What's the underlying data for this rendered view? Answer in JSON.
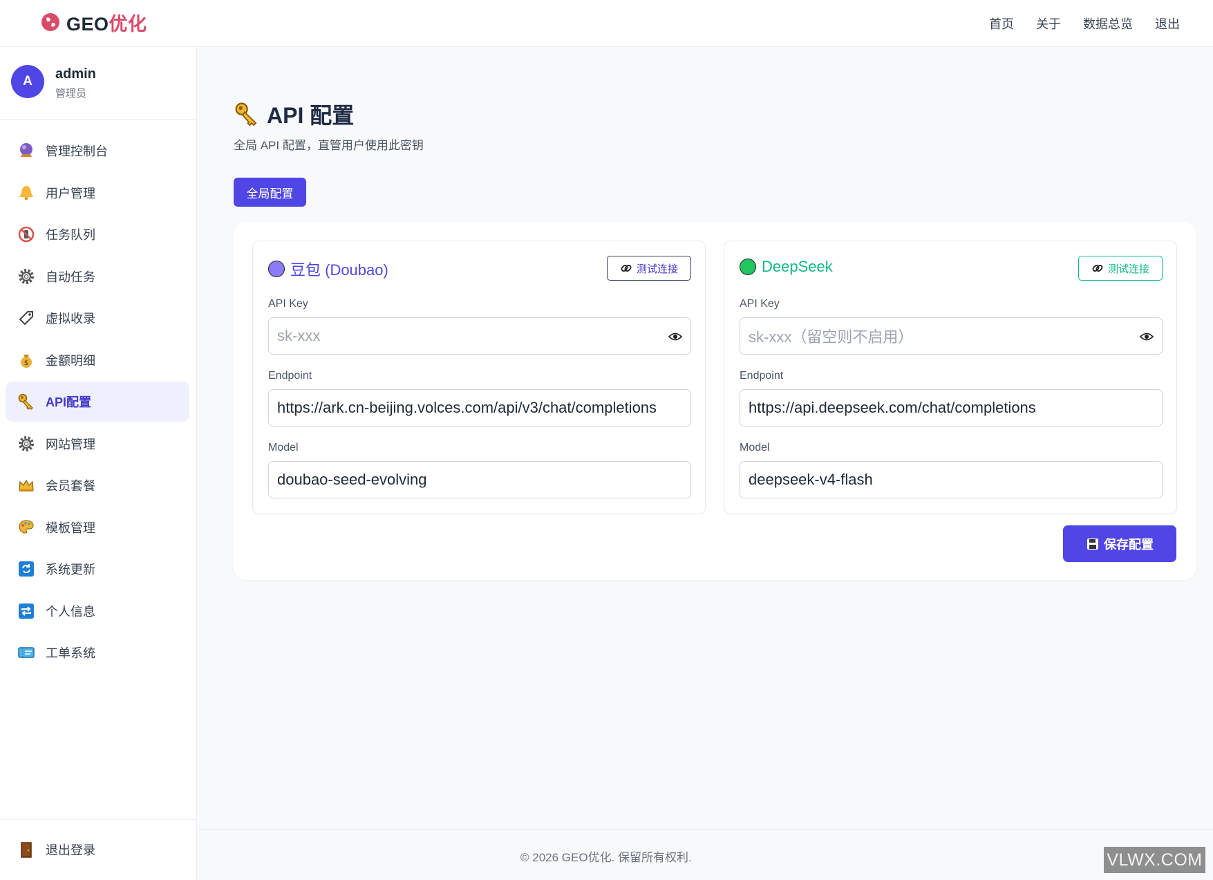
{
  "brand": {
    "name_prefix": "GEO",
    "name_suffix": "优化"
  },
  "topnav": [
    "首页",
    "关于",
    "数据总览",
    "退出"
  ],
  "user": {
    "avatar": "A",
    "name": "admin",
    "role": "管理员"
  },
  "sidebar": {
    "items": [
      {
        "label": "管理控制台",
        "icon": "crystal-ball-icon"
      },
      {
        "label": "用户管理",
        "icon": "bell-icon"
      },
      {
        "label": "任务队列",
        "icon": "no-phone-icon"
      },
      {
        "label": "自动任务",
        "icon": "gear-icon"
      },
      {
        "label": "虚拟收录",
        "icon": "label-tag-icon"
      },
      {
        "label": "金额明细",
        "icon": "money-bag-icon"
      },
      {
        "label": "API配置",
        "icon": "key-icon",
        "active": true
      },
      {
        "label": "网站管理",
        "icon": "gear-icon"
      },
      {
        "label": "会员套餐",
        "icon": "crown-icon"
      },
      {
        "label": "模板管理",
        "icon": "palette-icon"
      },
      {
        "label": "系统更新",
        "icon": "refresh-icon"
      },
      {
        "label": "个人信息",
        "icon": "repeat-icon"
      },
      {
        "label": "工单系统",
        "icon": "ticket-icon"
      }
    ],
    "logout": {
      "label": "退出登录",
      "icon": "door-icon"
    }
  },
  "page": {
    "title": "API 配置",
    "subtitle": "全局 API 配置，直管用户使用此密钥",
    "tab": "全局配置"
  },
  "providers": [
    {
      "name": "豆包 (Doubao)",
      "dot_color": "#8b7cf6",
      "title_color": "#4f46e5",
      "test_label": "测试连接",
      "test_color": "#374151",
      "api_key_label": "API Key",
      "api_key_placeholder": "sk-xxx",
      "endpoint_label": "Endpoint",
      "endpoint": "https://ark.cn-beijing.volces.com/api/v3/chat/completions",
      "model_label": "Model",
      "model": "doubao-seed-evolving"
    },
    {
      "name": "DeepSeek",
      "dot_color": "#22c55e",
      "title_color": "#10b981",
      "test_label": "测试连接",
      "test_color": "#10b981",
      "api_key_label": "API Key",
      "api_key_placeholder": "sk-xxx（留空则不启用）",
      "endpoint_label": "Endpoint",
      "endpoint": "https://api.deepseek.com/chat/completions",
      "model_label": "Model",
      "model": "deepseek-v4-flash"
    }
  ],
  "save_label": "保存配置",
  "footer": "© 2026 GEO优化. 保留所有权利.",
  "watermark": "VLWX.COM",
  "colors": {
    "accent": "#4f46e5",
    "brand_red": "#d94b6a"
  }
}
